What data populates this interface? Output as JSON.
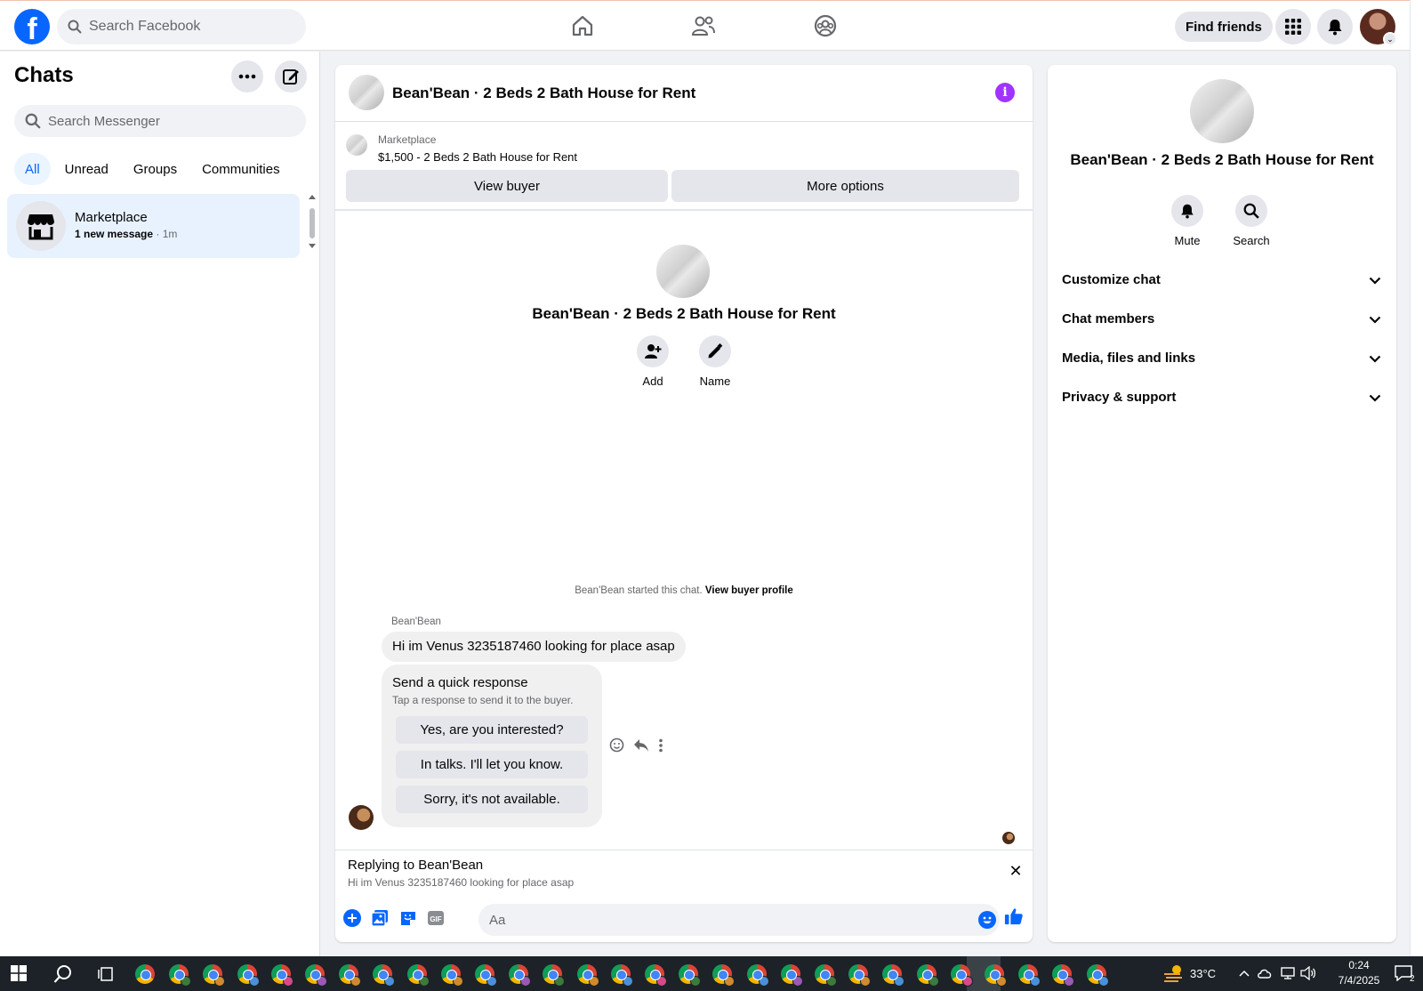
{
  "topbar": {
    "search_placeholder": "Search Facebook",
    "find_friends": "Find friends",
    "nav": [
      "home-icon",
      "friends-icon",
      "groups-icon"
    ],
    "accent": "#0866ff"
  },
  "sidebar": {
    "title": "Chats",
    "search_placeholder": "Search Messenger",
    "filters": [
      "All",
      "Unread",
      "Groups",
      "Communities"
    ],
    "active_filter": "All",
    "conversation": {
      "name": "Marketplace",
      "preview": "1 new message",
      "time": " · 1m"
    }
  },
  "chat": {
    "title": "Bean'Bean · 2 Beds 2 Bath House for Rent",
    "marketplace_label": "Marketplace",
    "listing": "$1,500 - 2 Beds 2 Bath House for Rent",
    "view_buyer": "View buyer",
    "more_options": "More options",
    "intro_title": "Bean'Bean · 2 Beds 2 Bath House for Rent",
    "add_label": "Add",
    "name_label": "Name",
    "started_text": "Bean'Bean started this chat. ",
    "view_buyer_profile": "View buyer profile",
    "sender": "Bean'Bean",
    "message": "Hi im Venus 3235187460 looking for place asap",
    "quick_title": "Send a quick response",
    "quick_sub": "Tap a response to send it to the buyer.",
    "quick_responses": [
      "Yes, are you interested?",
      "In talks. I'll let you know.",
      "Sorry, it's not available."
    ],
    "replying_to": "Replying to Bean'Bean",
    "replying_text": "Hi im Venus 3235187460 looking for place asap",
    "composer_placeholder": "Aa"
  },
  "info_panel": {
    "title": "Bean'Bean · 2 Beds 2 Bath House for Rent",
    "mute_label": "Mute",
    "search_label": "Search",
    "sections": [
      "Customize chat",
      "Chat members",
      "Media, files and links",
      "Privacy & support"
    ]
  },
  "taskbar": {
    "temperature": "33°C",
    "time": "0:24",
    "date": "7/4/2025",
    "notifications": "2"
  }
}
